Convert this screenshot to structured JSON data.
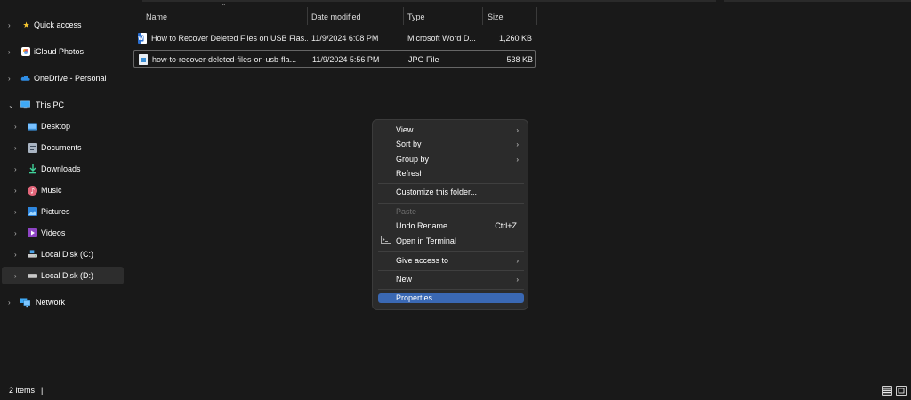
{
  "sidebar": {
    "items": [
      {
        "label": "Quick access",
        "icon": "star-icon"
      },
      {
        "label": "iCloud Photos",
        "icon": "icloud-photos-icon"
      },
      {
        "label": "OneDrive - Personal",
        "icon": "cloud-icon"
      },
      {
        "label": "This PC",
        "icon": "monitor-icon"
      },
      {
        "label": "Desktop",
        "icon": "desktop-folder-icon"
      },
      {
        "label": "Documents",
        "icon": "documents-folder-icon"
      },
      {
        "label": "Downloads",
        "icon": "download-arrow-icon"
      },
      {
        "label": "Music",
        "icon": "music-icon"
      },
      {
        "label": "Pictures",
        "icon": "pictures-icon"
      },
      {
        "label": "Videos",
        "icon": "videos-icon"
      },
      {
        "label": "Local Disk (C:)",
        "icon": "drive-icon"
      },
      {
        "label": "Local Disk (D:)",
        "icon": "drive-icon"
      },
      {
        "label": "Network",
        "icon": "network-icon"
      }
    ]
  },
  "columns": {
    "name": "Name",
    "date": "Date modified",
    "type": "Type",
    "size": "Size"
  },
  "files": [
    {
      "name": "How to Recover Deleted Files on USB Flas...",
      "date": "11/9/2024 6:08 PM",
      "type": "Microsoft Word D...",
      "size": "1,260 KB",
      "icon": "word-document-icon"
    },
    {
      "name": "how-to-recover-deleted-files-on-usb-fla...",
      "date": "11/9/2024 5:56 PM",
      "type": "JPG File",
      "size": "538 KB",
      "icon": "image-file-icon"
    }
  ],
  "context_menu": {
    "view": "View",
    "sort_by": "Sort by",
    "group_by": "Group by",
    "refresh": "Refresh",
    "customize": "Customize this folder...",
    "paste": "Paste",
    "undo_rename": "Undo Rename",
    "undo_shortcut": "Ctrl+Z",
    "open_terminal": "Open in Terminal",
    "give_access": "Give access to",
    "new": "New",
    "properties": "Properties"
  },
  "status": {
    "items": "2 items",
    "caret": "|"
  },
  "colors": {
    "background": "#191919",
    "menu": "#2b2b2b",
    "highlight": "#3a68b3"
  }
}
